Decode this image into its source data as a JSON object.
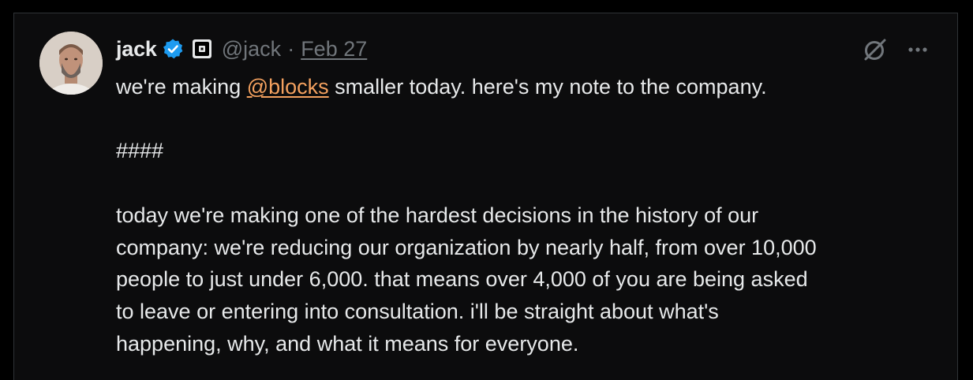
{
  "tweet": {
    "author_name": "jack",
    "handle": "@jack",
    "separator": "·",
    "date": "Feb 27",
    "text_prefix": "we're making ",
    "mention": "@blocks",
    "text_suffix": " smaller today. here's my note to the company.",
    "divider": "####",
    "paragraph_lines": [
      "today we're making one of the hardest decisions in the history of our",
      "company: we're reducing our organization by nearly half, from over 10,000",
      "people to just under 6,000. that means over 4,000 of you are being asked",
      "to leave or entering into consultation. i'll be straight about what's",
      "happening, why, and what it means for everyone."
    ]
  },
  "icons": {
    "verified": "verified-badge-icon",
    "affiliation": "block-affiliate-badge-icon",
    "grok": "grok-icon",
    "more": "more-options-icon"
  },
  "colors": {
    "background": "#0c0c0d",
    "text": "#e7e9ea",
    "muted": "#71767b",
    "mention": "#f4a15f",
    "verified_blue": "#1d9bf0"
  }
}
